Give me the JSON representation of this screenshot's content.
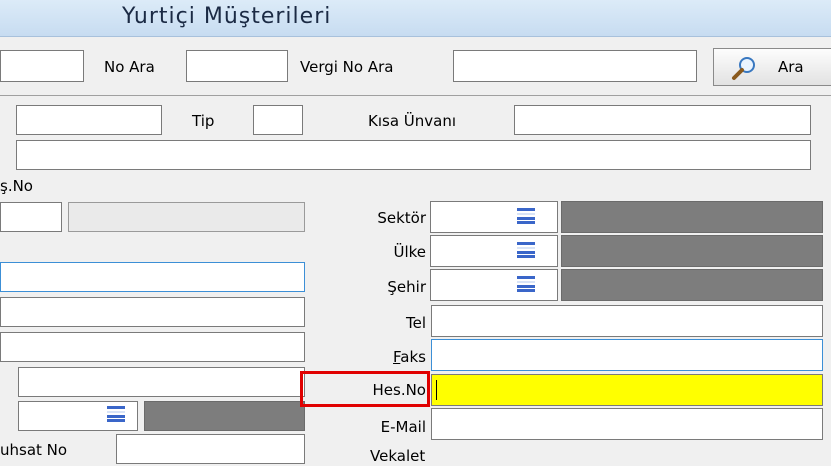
{
  "window": {
    "title": "Yurtiçi Müşterileri"
  },
  "search": {
    "no_label": "No Ara",
    "vergi_label": "Vergi No Ara",
    "button_label": "Ara"
  },
  "form": {
    "tip_label": "Tip",
    "kisa_unvan_label": "Kısa Ünvanı",
    "is_no_label": "ş.No",
    "sektor_label": "Sektör",
    "ulke_label": "Ülke",
    "sehir_label": "Şehir",
    "tel_label": "Tel",
    "faks_label": "Faks",
    "hes_no_label": "Hes.No",
    "email_label": "E-Mail",
    "ruhsat_label": "uhsat No",
    "vekalet_label": "Vekalet"
  },
  "colors": {
    "highlight": "#ffff00",
    "focus_border": "#3c8fd6",
    "annotation": "#e00000"
  }
}
